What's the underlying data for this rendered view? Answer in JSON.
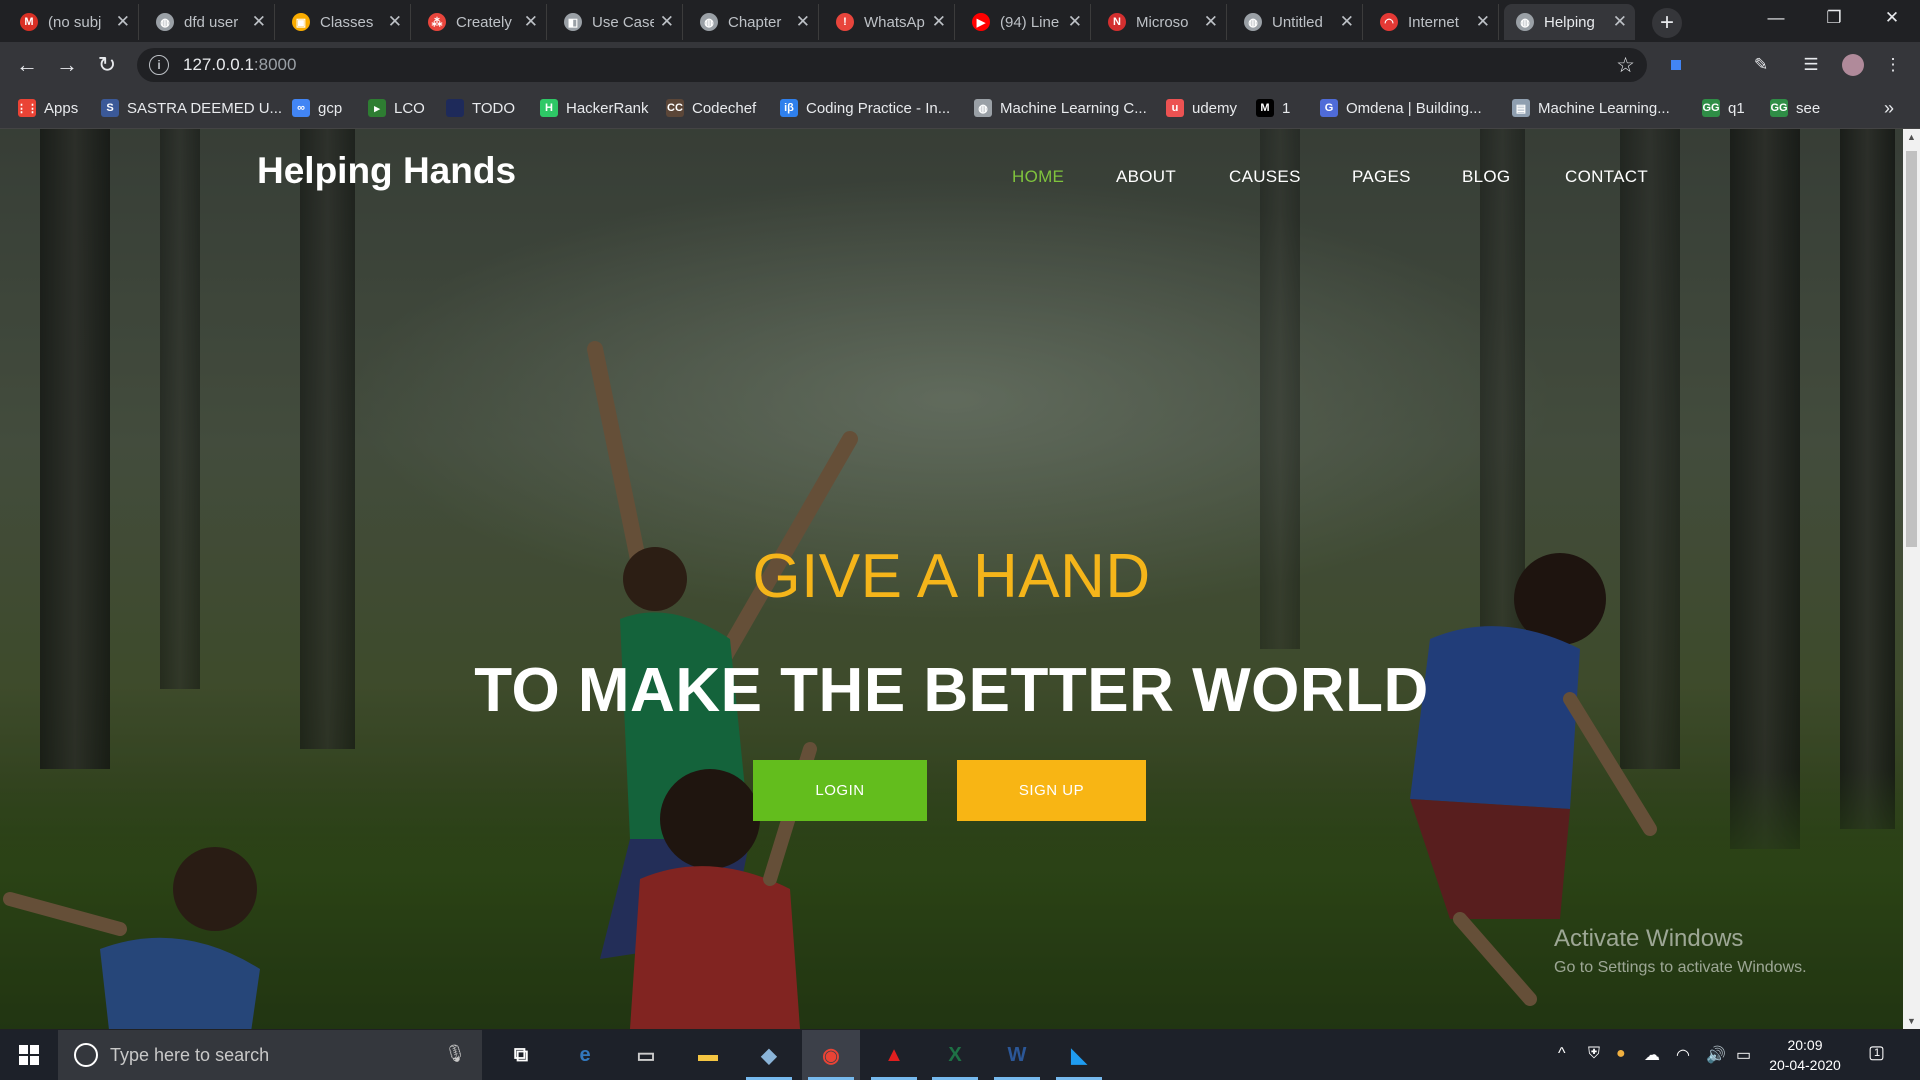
{
  "browser": {
    "tabs": [
      {
        "label": "(no subj",
        "icon": "gmail-icon",
        "color": "#d93025",
        "glyph": "M"
      },
      {
        "label": "dfd user",
        "icon": "globe-icon",
        "color": "#9aa0a6",
        "glyph": "◍"
      },
      {
        "label": "Classes",
        "icon": "classroom-icon",
        "color": "#f9ab00",
        "glyph": "▣"
      },
      {
        "label": "Creately",
        "icon": "creately-icon",
        "color": "#e8453c",
        "glyph": "⁂"
      },
      {
        "label": "Use Case",
        "icon": "box-icon",
        "color": "#9aa0a6",
        "glyph": "◧"
      },
      {
        "label": "Chapter",
        "icon": "globe-icon",
        "color": "#9aa0a6",
        "glyph": "◍"
      },
      {
        "label": "WhatsAp",
        "icon": "warning-icon",
        "color": "#e8453c",
        "glyph": "!"
      },
      {
        "label": "(94) Line",
        "icon": "youtube-icon",
        "color": "#ff0000",
        "glyph": "▶"
      },
      {
        "label": "Microso",
        "icon": "microsoft-icon",
        "color": "#d32f2f",
        "glyph": "N"
      },
      {
        "label": "Untitled",
        "icon": "globe-icon",
        "color": "#9aa0a6",
        "glyph": "◍"
      },
      {
        "label": "Internet",
        "icon": "gauge-icon",
        "color": "#e53935",
        "glyph": "◠"
      },
      {
        "label": "Helping",
        "icon": "globe-icon",
        "color": "#9aa0a6",
        "glyph": "◍",
        "active": true
      }
    ],
    "close_glyph": "✕",
    "new_tab_glyph": "+",
    "url_host": "127.0.0.1",
    "url_port": ":8000",
    "bookmarks": [
      {
        "label": "Apps",
        "icon": "apps-grid-icon",
        "color": "#ea4335",
        "glyph": "⋮⋮"
      },
      {
        "label": "SASTRA DEEMED U...",
        "icon": "sastra-icon",
        "color": "#3b5998",
        "glyph": "S"
      },
      {
        "label": "gcp",
        "icon": "gcp-icon",
        "color": "#4285f4",
        "glyph": "∞"
      },
      {
        "label": "LCO",
        "icon": "lco-icon",
        "color": "#2e7d32",
        "glyph": "▸"
      },
      {
        "label": "TODO",
        "icon": "todo-icon",
        "color": "#1e2a5a",
        "glyph": " "
      },
      {
        "label": "HackerRank",
        "icon": "hackerrank-icon",
        "color": "#2ec866",
        "glyph": "H"
      },
      {
        "label": "Codechef",
        "icon": "codechef-icon",
        "color": "#5b4638",
        "glyph": "CC"
      },
      {
        "label": "Coding Practice - In...",
        "icon": "interviewbit-icon",
        "color": "#2f80ed",
        "glyph": "iβ"
      },
      {
        "label": "Machine Learning C...",
        "icon": "globe-icon",
        "color": "#9aa0a6",
        "glyph": "◍"
      },
      {
        "label": "udemy",
        "icon": "udemy-icon",
        "color": "#ec5252",
        "glyph": "u"
      },
      {
        "label": "1",
        "icon": "medium-icon",
        "color": "#000000",
        "glyph": "M"
      },
      {
        "label": "Omdena | Building...",
        "icon": "omdena-icon",
        "color": "#4f6bd8",
        "glyph": "G"
      },
      {
        "label": "Machine Learning...",
        "icon": "ml-icon",
        "color": "#8f9fb0",
        "glyph": "▤"
      },
      {
        "label": "q1",
        "icon": "gfg-icon",
        "color": "#2f8d46",
        "glyph": "GG"
      },
      {
        "label": "see",
        "icon": "gfg-icon",
        "color": "#2f8d46",
        "glyph": "GG"
      }
    ],
    "overflow_glyph": "»"
  },
  "site": {
    "brand": "Helping Hands",
    "nav": [
      {
        "label": "HOME",
        "active": true
      },
      {
        "label": "ABOUT"
      },
      {
        "label": "CAUSES"
      },
      {
        "label": "PAGES"
      },
      {
        "label": "BLOG"
      },
      {
        "label": "CONTACT"
      }
    ],
    "hero_kicker": "GIVE A HAND",
    "hero_title": "TO MAKE THE BETTER WORLD",
    "login_label": "LOGIN",
    "signup_label": "SIGN UP",
    "colors": {
      "accent_green": "#63bd1d",
      "accent_yellow": "#f8b514",
      "nav_active": "#7fc33d"
    }
  },
  "watermark": {
    "title": "Activate Windows",
    "subtitle": "Go to Settings to activate Windows."
  },
  "taskbar": {
    "search_placeholder": "Type here to search",
    "apps": [
      {
        "name": "task-view-icon",
        "glyph": "⧉",
        "color": "#ffffff"
      },
      {
        "name": "edge-icon",
        "glyph": "e",
        "color": "#3277bc"
      },
      {
        "name": "terminal-icon",
        "glyph": "▭",
        "color": "#cccccc"
      },
      {
        "name": "file-explorer-icon",
        "glyph": "▬",
        "color": "#f4c542"
      },
      {
        "name": "notepad-icon",
        "glyph": "◆",
        "color": "#8ab4d8"
      },
      {
        "name": "chrome-icon",
        "glyph": "◉",
        "color": "#ea4335"
      },
      {
        "name": "acrobat-icon",
        "glyph": "▲",
        "color": "#e01f1f"
      },
      {
        "name": "excel-icon",
        "glyph": "X",
        "color": "#1e7145"
      },
      {
        "name": "word-icon",
        "glyph": "W",
        "color": "#2b5797"
      },
      {
        "name": "vscode-icon",
        "glyph": "◣",
        "color": "#1f9cf0"
      }
    ],
    "time": "20:09",
    "date": "20-04-2020",
    "notification_count": "1"
  }
}
